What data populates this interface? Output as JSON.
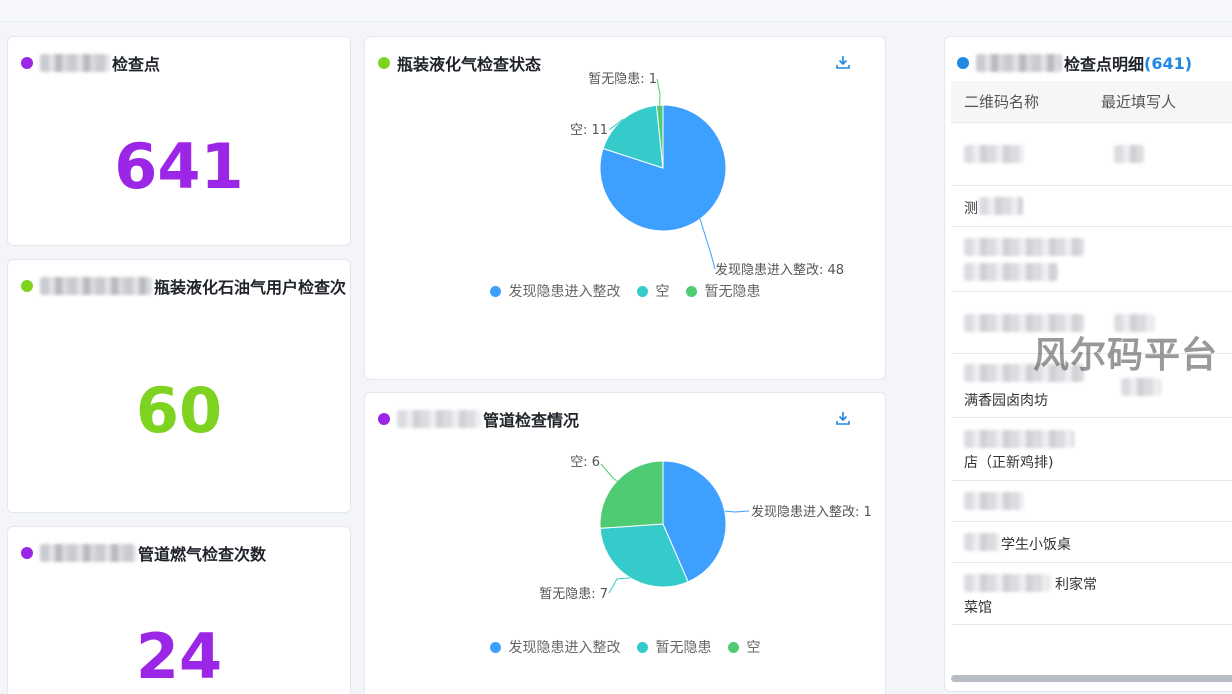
{
  "cards": {
    "c1": {
      "title_suffix": "检查点",
      "value": "641",
      "dot_color": "#9b26e6",
      "value_color": "#9b26e6"
    },
    "c2": {
      "title_suffix": "瓶装液化石油气用户检查次",
      "value": "60",
      "dot_color": "#7ed321",
      "value_color": "#7ed321"
    },
    "c3": {
      "title_suffix": "管道燃气检查次数",
      "value": "24",
      "dot_color": "#9b26e6",
      "value_color": "#9b26e6"
    }
  },
  "pie1": {
    "title": "瓶装液化气检查状态",
    "dot_color": "#7ed321",
    "labels": [
      "发现隐患进入整改: 48",
      "空: 11",
      "暂无隐患: 1"
    ],
    "legend": [
      "发现隐患进入整改",
      "空",
      "暂无隐患"
    ],
    "colors": [
      "#3d9ffe",
      "#36cbcb",
      "#4ecb73"
    ]
  },
  "pie2": {
    "title": "管道检查情况",
    "dot_color": "#9b26e6",
    "labels": [
      "发现隐患进入整改: 1",
      "暂无隐患: 7",
      "空: 6"
    ],
    "legend": [
      "发现隐患进入整改",
      "暂无隐患",
      "空"
    ],
    "colors": [
      "#3d9ffe",
      "#36cbcb",
      "#4ecb73"
    ]
  },
  "chart_data": [
    {
      "type": "pie",
      "title": "瓶装液化气检查状态",
      "categories": [
        "发现隐患进入整改",
        "空",
        "暂无隐患"
      ],
      "values": [
        48,
        11,
        1
      ],
      "legend_position": "bottom"
    },
    {
      "type": "pie",
      "title": "管道检查情况",
      "categories": [
        "发现隐患进入整改",
        "暂无隐患",
        "空"
      ],
      "values": [
        10,
        7,
        6
      ],
      "legend_position": "bottom"
    }
  ],
  "detail": {
    "title_suffix": "检查点明细",
    "count": "(641)",
    "dot_color": "#1e88e5",
    "columns": [
      "二维码名称",
      "最近填写人"
    ],
    "rows": [
      {
        "line1": "",
        "line2": ""
      },
      {
        "line1": "测",
        "line2": ""
      },
      {
        "line1": "",
        "line2": ""
      },
      {
        "line1": "",
        "line2": ""
      },
      {
        "line1": "满香园卤肉坊",
        "line2": ""
      },
      {
        "line1": "",
        "line2": "店（正新鸡排)"
      },
      {
        "line1": "",
        "line2": ""
      },
      {
        "line1": "学生小饭桌",
        "line2": ""
      },
      {
        "line1": "利家常",
        "line2": "菜馆"
      }
    ]
  },
  "watermark": "风尔码平台"
}
